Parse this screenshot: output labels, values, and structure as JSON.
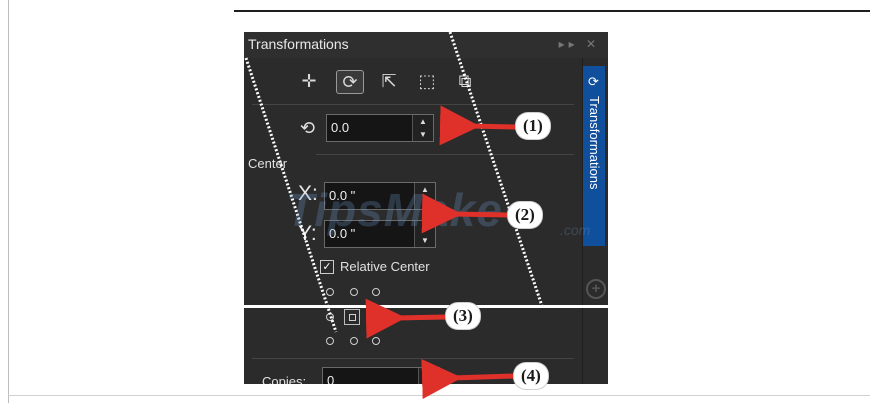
{
  "panel": {
    "title": "Transformations",
    "window_buttons": "▸▸ ✕",
    "side_tab_label": "Transformations"
  },
  "toolbar": {
    "icons": [
      {
        "name": "position-icon",
        "glyph": "✛",
        "active": false
      },
      {
        "name": "rotate-icon",
        "glyph": "⟳",
        "active": true
      },
      {
        "name": "scale-icon",
        "glyph": "⇱",
        "active": false
      },
      {
        "name": "size-icon",
        "glyph": "⬚",
        "active": false
      },
      {
        "name": "skew-icon",
        "glyph": "⧉",
        "active": false
      }
    ]
  },
  "rotation": {
    "value": "0.0",
    "icon": "rotate-icon"
  },
  "center": {
    "label": "Center",
    "x_label": "X:",
    "x_value": "0.0 \"",
    "y_label": "Y:",
    "y_value": "0.0 \"",
    "relative_center_label": "Relative Center",
    "relative_center_checked": true
  },
  "copies": {
    "label": "Copies:",
    "value": "0"
  },
  "annotations": [
    "(1)",
    "(2)",
    "(3)",
    "(4)"
  ],
  "watermark": {
    "text": "TipsMake",
    "suffix": ".com"
  },
  "colors": {
    "panel_bg": "#2b2b2b",
    "accent_tab": "#0f4f9c",
    "arrow_red": "#e0302a"
  }
}
